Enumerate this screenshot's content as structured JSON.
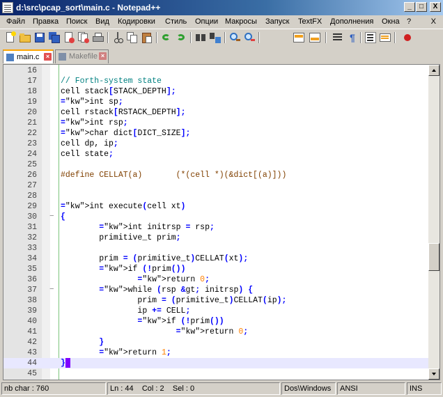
{
  "window": {
    "title": "d:\\src\\pcap_sort\\main.c - Notepad++",
    "minimize": "_",
    "maximize": "□",
    "close": "X"
  },
  "menu": {
    "items": [
      "Файл",
      "Правка",
      "Поиск",
      "Вид",
      "Кодировки",
      "Стиль",
      "Опции",
      "Макросы",
      "Запуск",
      "TextFX",
      "Дополнения",
      "Окна",
      "?"
    ],
    "close": "X"
  },
  "toolbar": {
    "icons": [
      "new-file-icon",
      "open-file-icon",
      "save-icon",
      "save-all-icon",
      "close-icon",
      "close-all-icon",
      "print-icon",
      "cut-icon",
      "copy-icon",
      "paste-icon",
      "undo-icon",
      "redo-icon",
      "find-icon",
      "replace-icon",
      "zoom-in-icon",
      "zoom-out-icon",
      "sync-vertical-icon",
      "sync-horizontal-icon",
      "word-wrap-icon",
      "show-all-chars-icon",
      "indent-guide-icon",
      "user-lang-icon",
      "record-macro-icon"
    ]
  },
  "tabs": [
    {
      "label": "main.c",
      "active": true
    },
    {
      "label": "Makefile",
      "active": false
    }
  ],
  "editor": {
    "current_line": "44",
    "lines": [
      {
        "n": "16",
        "code": ""
      },
      {
        "n": "17",
        "code": "// Forth-system state"
      },
      {
        "n": "18",
        "code": "cell stack[STACK_DEPTH];"
      },
      {
        "n": "19",
        "code": "int sp;"
      },
      {
        "n": "20",
        "code": "cell rstack[RSTACK_DEPTH];"
      },
      {
        "n": "21",
        "code": "int rsp;"
      },
      {
        "n": "22",
        "code": "char dict[DICT_SIZE];"
      },
      {
        "n": "23",
        "code": "cell dp, ip;"
      },
      {
        "n": "24",
        "code": "cell state;"
      },
      {
        "n": "25",
        "code": ""
      },
      {
        "n": "26",
        "code": "#define CELLAT(a)       (*(cell *)(&dict[(a)]))"
      },
      {
        "n": "27",
        "code": ""
      },
      {
        "n": "28",
        "code": ""
      },
      {
        "n": "29",
        "code": "int execute(cell xt)"
      },
      {
        "n": "30",
        "code": "{"
      },
      {
        "n": "31",
        "code": "        int initrsp = rsp;"
      },
      {
        "n": "32",
        "code": "        primitive_t prim;"
      },
      {
        "n": "33",
        "code": ""
      },
      {
        "n": "34",
        "code": "        prim = (primitive_t)CELLAT(xt);"
      },
      {
        "n": "35",
        "code": "        if (!prim())"
      },
      {
        "n": "36",
        "code": "                return 0;"
      },
      {
        "n": "37",
        "code": "        while (rsp > initrsp) {"
      },
      {
        "n": "38",
        "code": "                prim = (primitive_t)CELLAT(ip);"
      },
      {
        "n": "39",
        "code": "                ip += CELL;"
      },
      {
        "n": "40",
        "code": "                if (!prim())"
      },
      {
        "n": "41",
        "code": "                        return 0;"
      },
      {
        "n": "42",
        "code": "        }"
      },
      {
        "n": "43",
        "code": "        return 1;"
      },
      {
        "n": "44",
        "code": "}"
      },
      {
        "n": "45",
        "code": ""
      }
    ]
  },
  "status": {
    "chars": "nb char : 760",
    "position": "Ln : 44    Col : 2    Sel : 0",
    "eol": "Dos\\Windows",
    "encoding": "ANSI",
    "mode": "INS"
  }
}
